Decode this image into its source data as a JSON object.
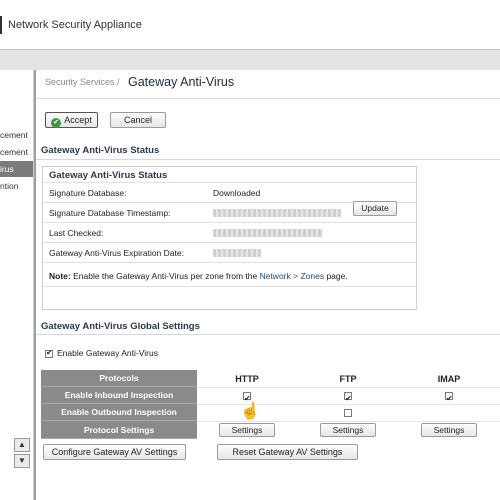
{
  "window": {
    "app_title": "Network Security Appliance"
  },
  "sidebar": {
    "items": [
      {
        "label": "cement",
        "active": false
      },
      {
        "label": "cement",
        "active": false
      },
      {
        "label": "irus",
        "active": true
      },
      {
        "label": "ntion",
        "active": false
      }
    ]
  },
  "breadcrumb": {
    "parent": "Security Services /",
    "current": "Gateway Anti-Virus"
  },
  "toolbar": {
    "accept_label": "Accept",
    "cancel_label": "Cancel"
  },
  "status_section": {
    "heading": "Gateway Anti-Virus Status",
    "box_title": "Gateway Anti-Virus Status",
    "rows": [
      {
        "label": "Signature Database:",
        "value": "Downloaded"
      },
      {
        "label": "Signature Database Timestamp:",
        "value": ""
      },
      {
        "label": "Last Checked:",
        "value": ""
      },
      {
        "label": "Gateway Anti-Virus Expiration Date:",
        "value": ""
      }
    ],
    "update_label": "Update",
    "note_bold": "Note:",
    "note_text": " Enable the Gateway Anti-Virus per zone from the ",
    "note_link": "Network > Zones",
    "note_tail": " page."
  },
  "global_section": {
    "heading": "Gateway Anti-Virus Global Settings",
    "enable_label": "Enable Gateway Anti-Virus",
    "enable_checked": true,
    "grid": {
      "row_labels": [
        "Protocols",
        "Enable Inbound Inspection",
        "Enable Outbound Inspection",
        "Protocol Settings"
      ],
      "columns": [
        "HTTP",
        "FTP",
        "IMAP"
      ],
      "inbound": [
        true,
        true,
        true
      ],
      "outbound": [
        true,
        false,
        null
      ],
      "settings_label": "Settings"
    },
    "configure_label": "Configure Gateway AV Settings",
    "reset_label": "Reset Gateway AV Settings"
  },
  "icons": {
    "accept": "check-circle-icon",
    "scroll_up": "arrow-up-icon",
    "scroll_down": "arrow-down-icon",
    "cursor": "hand-pointer-icon"
  }
}
